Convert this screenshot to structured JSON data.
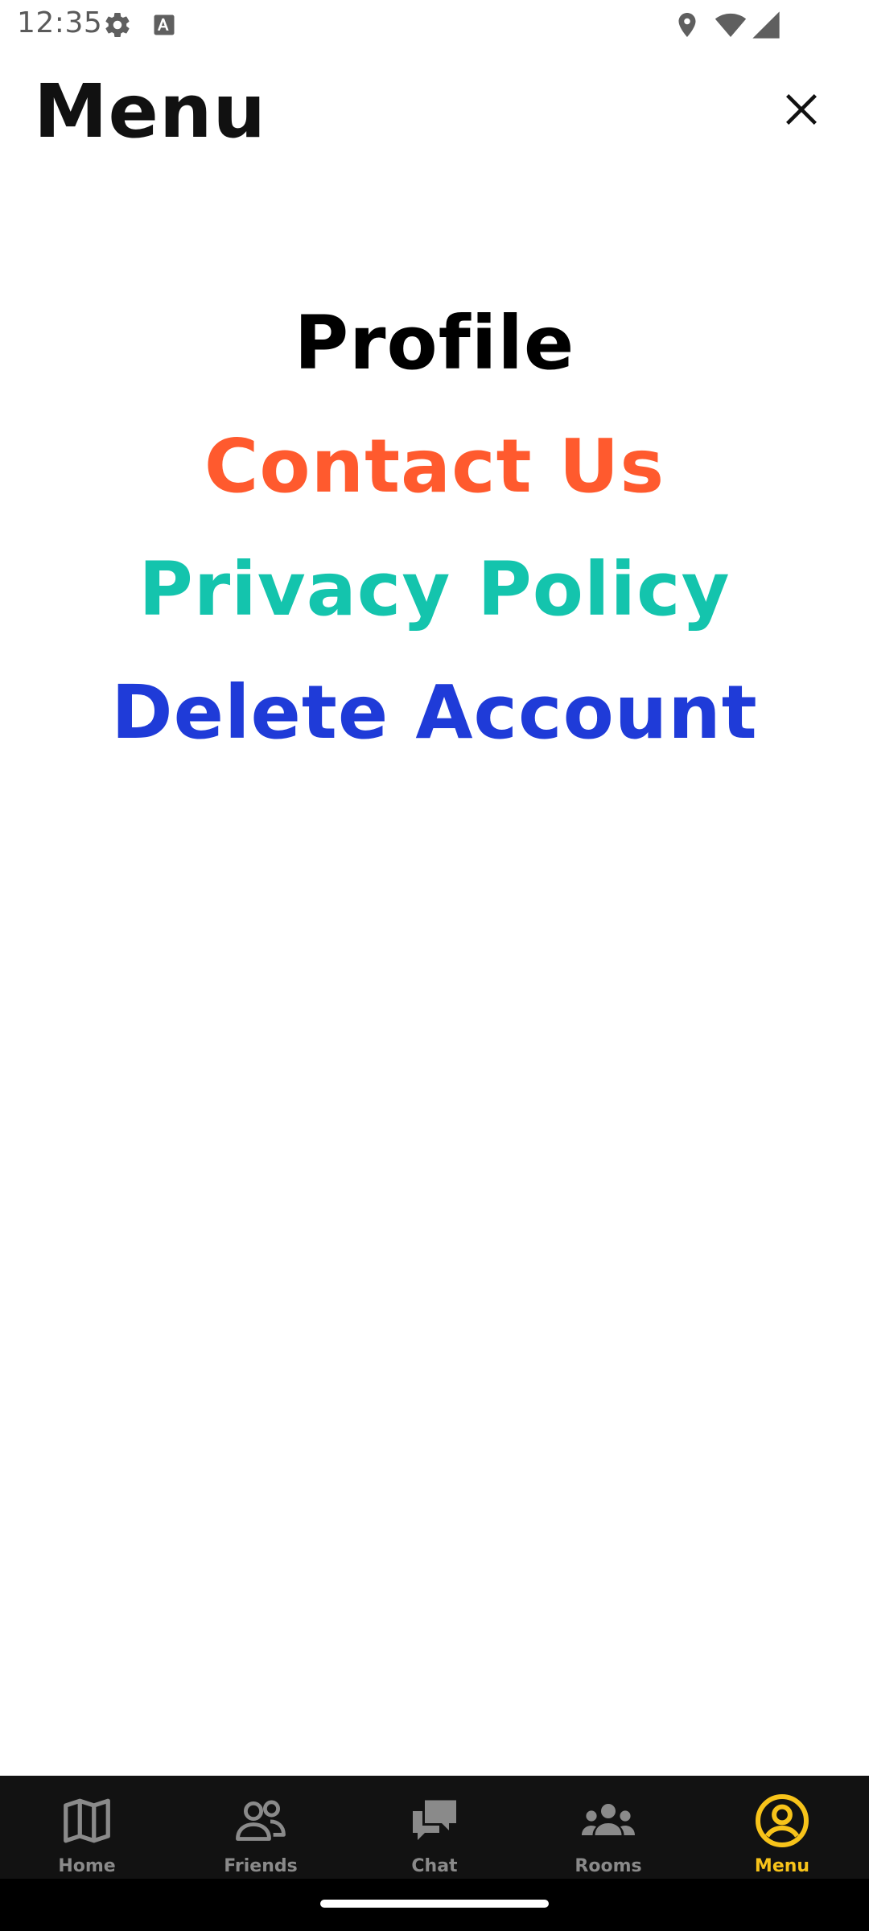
{
  "status_bar": {
    "time": "12:35",
    "icons": [
      "settings-icon",
      "a-icon",
      "location-icon",
      "wifi-icon",
      "signal-icon"
    ]
  },
  "header": {
    "title": "Menu",
    "close_icon": "close-icon"
  },
  "menu": {
    "items": [
      {
        "label": "Profile",
        "color": "#000000"
      },
      {
        "label": "Contact Us",
        "color": "#ff5a2e"
      },
      {
        "label": "Privacy Policy",
        "color": "#14c4ad"
      },
      {
        "label": "Delete Account",
        "color": "#1f3bd8"
      }
    ]
  },
  "bottom_nav": {
    "items": [
      {
        "label": "Home",
        "icon": "map-icon",
        "active": false
      },
      {
        "label": "Friends",
        "icon": "friends-icon",
        "active": false
      },
      {
        "label": "Chat",
        "icon": "chat-icon",
        "active": false
      },
      {
        "label": "Rooms",
        "icon": "rooms-icon",
        "active": false
      },
      {
        "label": "Menu",
        "icon": "account-circle-icon",
        "active": true
      }
    ],
    "active_color": "#f7c31a",
    "inactive_color": "#8a8a8a",
    "background": "#121212"
  }
}
